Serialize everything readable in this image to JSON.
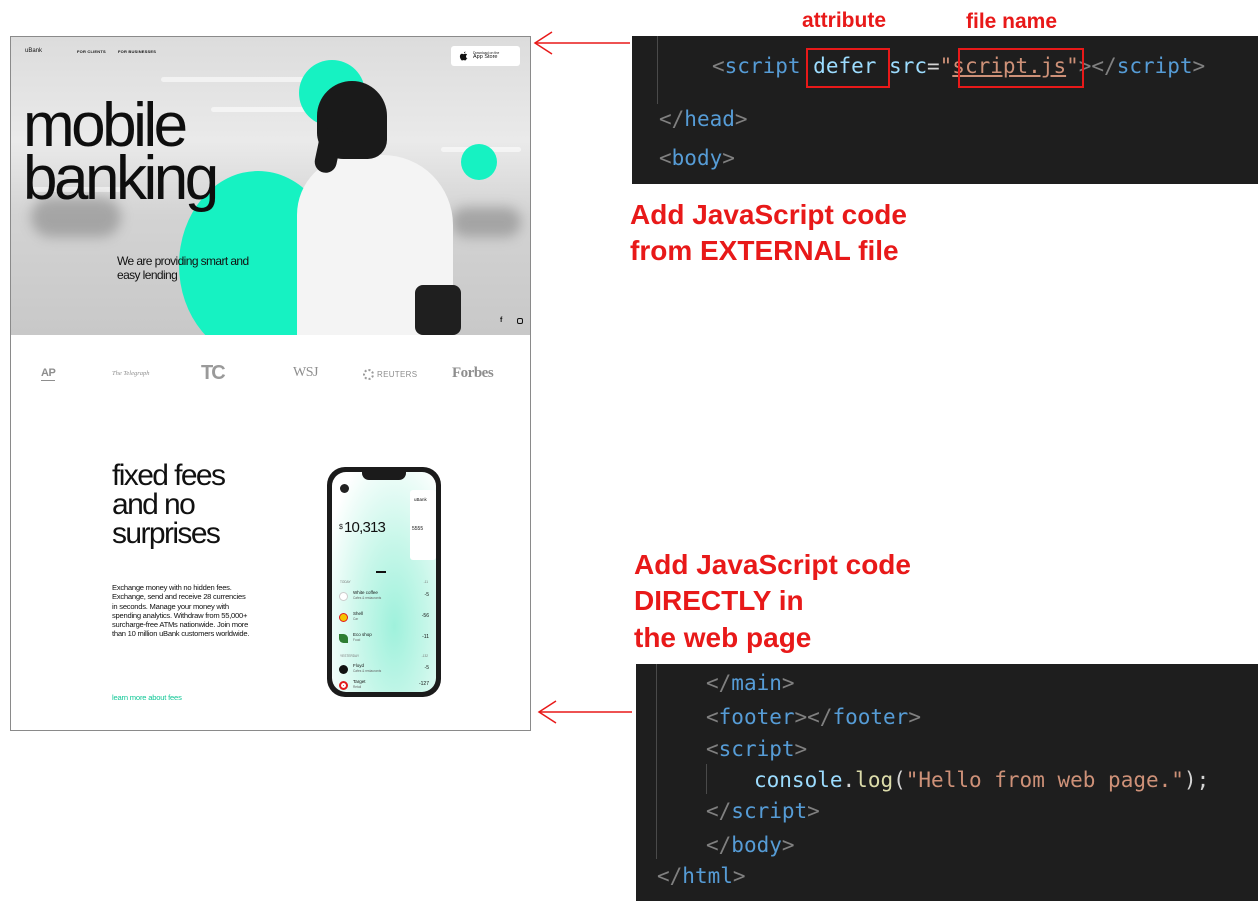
{
  "website": {
    "brand": "uBank",
    "nav": {
      "clients": "FOR CLIENTS",
      "businesses": "FOR BUSINESSES"
    },
    "store": {
      "small": "Download on the",
      "big": "App Store"
    },
    "hero": {
      "title_line1": "mobile",
      "title_line2": "banking",
      "subtitle": "We are providing smart and easy lending"
    },
    "social": {
      "facebook": "f"
    },
    "press": {
      "ap": "AP",
      "telegraph": "The Telegraph",
      "techcrunch": "TC",
      "wsj": "WSJ",
      "reuters": "REUTERS",
      "forbes": "Forbes"
    },
    "fees": {
      "title_line1": "fixed fees",
      "title_line2": "and no",
      "title_line3": "surprises",
      "body": "Exchange money with no hidden fees. Exchange, send and receive 28 currencies in seconds. Manage your money with spending analytics. Withdraw from 55,000+ surcharge-free ATMs nationwide. Join more than 10 million uBank customers worldwide.",
      "link": "learn more about fees"
    },
    "phone": {
      "brand": "uBank",
      "currency": "$",
      "balance": "10,313",
      "card_number": "5555",
      "group1_label": "TODAY",
      "group1_total": "-11",
      "group2_label": "YESTERDAY",
      "group2_total": "-132",
      "transactions": [
        {
          "name": "White coffee",
          "category": "Cafes & restaurants",
          "amount": "-5"
        },
        {
          "name": "Shell",
          "category": "Car",
          "amount": "-56"
        },
        {
          "name": "Eco shop",
          "category": "Food",
          "amount": "-11"
        },
        {
          "name": "Floyd",
          "category": "Cafes & restaurants",
          "amount": "-5"
        },
        {
          "name": "Target",
          "category": "Retail",
          "amount": "-127"
        }
      ]
    }
  },
  "code_top": {
    "annotation_attribute": "attribute",
    "annotation_filename": "file name",
    "line1": {
      "open": "<",
      "tag": "script",
      "attr_defer": "defer",
      "attr_src": "src",
      "eq": "=",
      "q1": "\"",
      "value": "script.js",
      "q2": "\"",
      "close_open": "></",
      "close_tag": "script",
      "gt": ">"
    },
    "line2": {
      "lt": "</",
      "tag": "head",
      "gt": ">"
    },
    "line3": {
      "lt": "<",
      "tag": "body",
      "gt": ">"
    }
  },
  "note_external": {
    "line1": "Add JavaScript code",
    "line2": "from EXTERNAL file"
  },
  "note_direct": {
    "line1": "Add JavaScript code",
    "line2": "DIRECTLY in",
    "line3": "the web page"
  },
  "code_bottom": {
    "main_close": {
      "lt": "</",
      "tag": "main",
      "gt": ">"
    },
    "footer": {
      "lt": "<",
      "tag": "footer",
      "mid": "></",
      "tag2": "footer",
      "gt": ">"
    },
    "script_open": {
      "lt": "<",
      "tag": "script",
      "gt": ">"
    },
    "console": {
      "obj": "console",
      "dot": ".",
      "fn": "log",
      "open": "(",
      "str": "\"Hello from web page.\"",
      "close": ");"
    },
    "script_close": {
      "lt": "</",
      "tag": "script",
      "gt": ">"
    },
    "body_close": {
      "lt": "</",
      "tag": "body",
      "gt": ">"
    },
    "html_close": {
      "lt": "</",
      "tag": "html",
      "gt": ">"
    }
  },
  "colors": {
    "mint": "#16f2c2",
    "annotation_red": "#e81919",
    "code_bg": "#1e1e1e"
  }
}
